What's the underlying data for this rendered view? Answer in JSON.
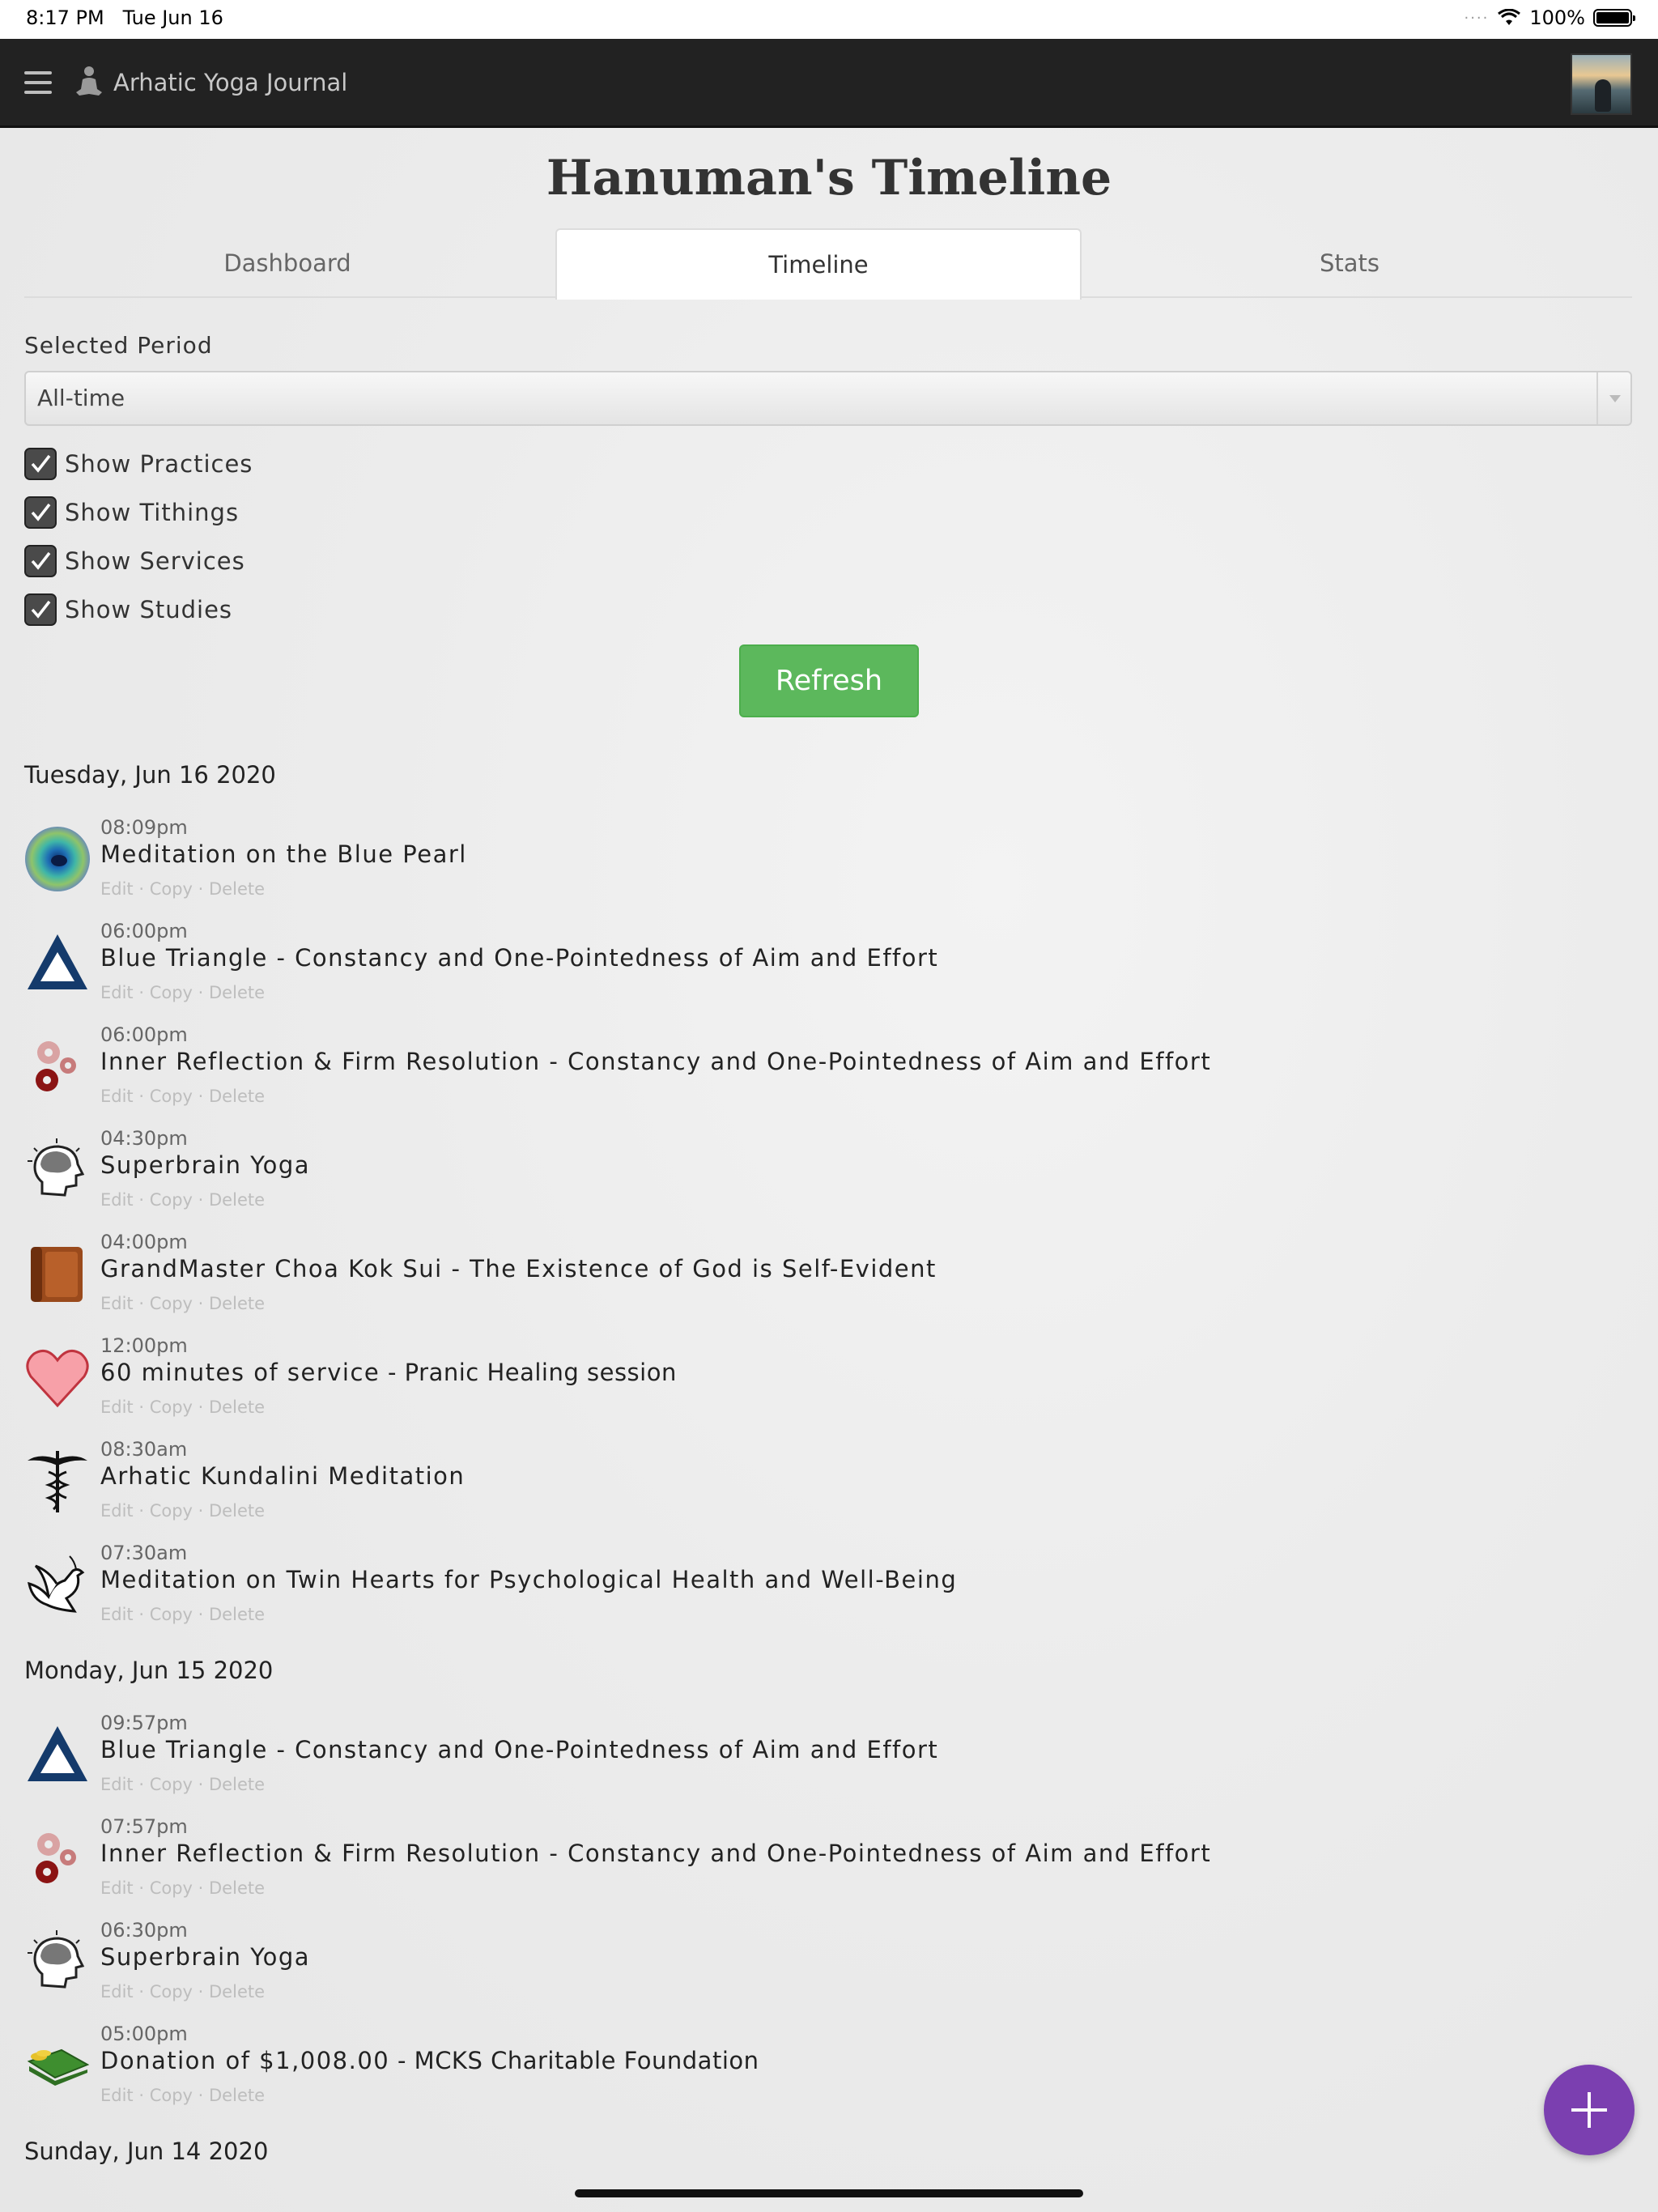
{
  "status_bar": {
    "time": "8:17 PM",
    "date": "Tue Jun 16",
    "battery": "100%"
  },
  "navbar": {
    "app_name": "Arhatic Yoga Journal"
  },
  "page": {
    "title": "Hanuman's Timeline"
  },
  "tabs": [
    {
      "label": "Dashboard",
      "active": false
    },
    {
      "label": "Timeline",
      "active": true
    },
    {
      "label": "Stats",
      "active": false
    }
  ],
  "filters": {
    "period_label": "Selected Period",
    "period_value": "All-time",
    "checkboxes": [
      {
        "label": "Show Practices",
        "checked": true
      },
      {
        "label": "Show Tithings",
        "checked": true
      },
      {
        "label": "Show Services",
        "checked": true
      },
      {
        "label": "Show Studies",
        "checked": true
      }
    ],
    "refresh_label": "Refresh"
  },
  "actions": {
    "edit": "Edit",
    "copy": "Copy",
    "delete": "Delete",
    "sep": " · "
  },
  "days": [
    {
      "date": "Tuesday, Jun 16 2020",
      "entries": [
        {
          "time": "08:09pm",
          "title": "Meditation on the Blue Pearl",
          "note": "",
          "icon": "blue-pearl-icon"
        },
        {
          "time": "06:00pm",
          "title": "Blue Triangle - Constancy and One-Pointedness of Aim and Effort",
          "note": "",
          "icon": "blue-triangle-icon"
        },
        {
          "time": "06:00pm",
          "title": "Inner Reflection & Firm Resolution - Constancy and One-Pointedness of Aim and Effort",
          "note": "",
          "icon": "gears-icon"
        },
        {
          "time": "04:30pm",
          "title": "Superbrain Yoga",
          "note": "",
          "icon": "brain-head-icon"
        },
        {
          "time": "04:00pm",
          "title": "GrandMaster Choa Kok Sui - The Existence of God is Self-Evident",
          "note": "",
          "icon": "book-icon"
        },
        {
          "time": "12:00pm",
          "title": "60 minutes of service",
          "note": " - Pranic Healing session",
          "icon": "heart-icon"
        },
        {
          "time": "08:30am",
          "title": "Arhatic Kundalini Meditation",
          "note": "",
          "icon": "caduceus-icon"
        },
        {
          "time": "07:30am",
          "title": "Meditation on Twin Hearts for Psychological Health and Well-Being",
          "note": "",
          "icon": "dove-icon"
        }
      ]
    },
    {
      "date": "Monday, Jun 15 2020",
      "entries": [
        {
          "time": "09:57pm",
          "title": "Blue Triangle - Constancy and One-Pointedness of Aim and Effort",
          "note": "",
          "icon": "blue-triangle-icon"
        },
        {
          "time": "07:57pm",
          "title": "Inner Reflection & Firm Resolution - Constancy and One-Pointedness of Aim and Effort",
          "note": "",
          "icon": "gears-icon"
        },
        {
          "time": "06:30pm",
          "title": "Superbrain Yoga",
          "note": "",
          "icon": "brain-head-icon"
        },
        {
          "time": "05:00pm",
          "title": "Donation of $1,008.00",
          "note": " - MCKS Charitable Foundation",
          "icon": "money-icon"
        }
      ]
    },
    {
      "date": "Sunday, Jun 14 2020",
      "entries": []
    }
  ]
}
